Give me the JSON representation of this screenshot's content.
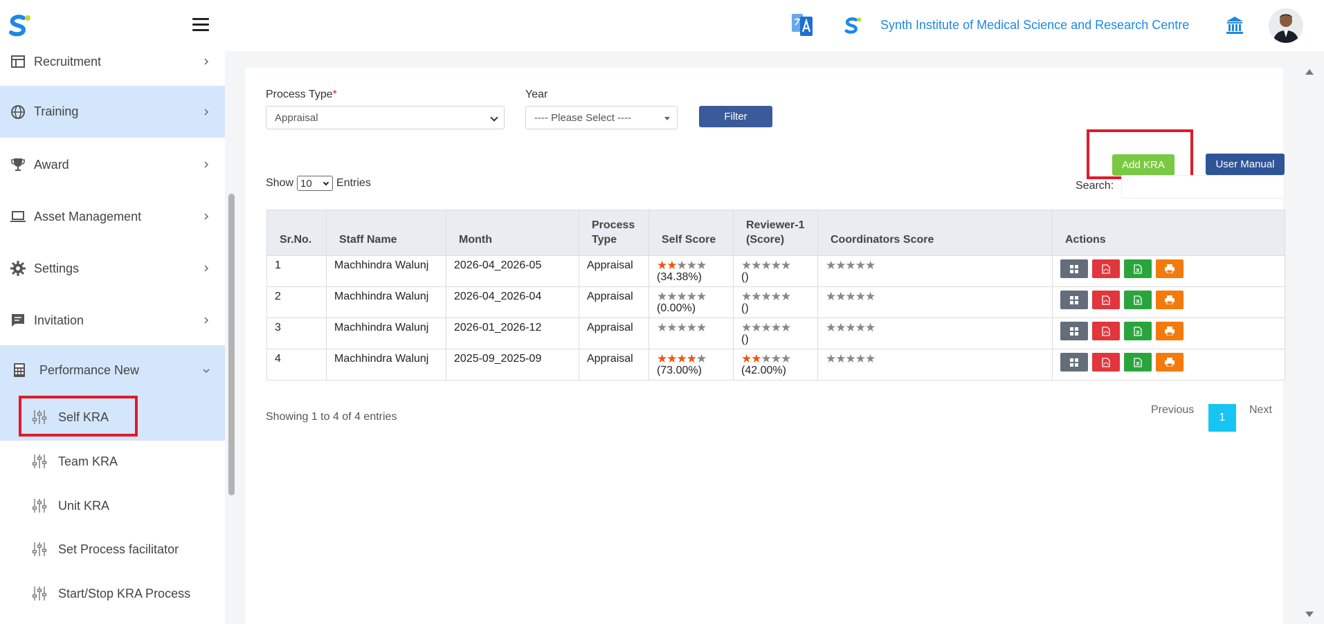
{
  "header": {
    "institute_name": "Synth Institute of Medical Science and Research Centre"
  },
  "sidebar": {
    "items": [
      {
        "label": "Recruitment",
        "icon": "recruitment-icon"
      },
      {
        "label": "Training",
        "icon": "globe-icon"
      },
      {
        "label": "Award",
        "icon": "trophy-icon"
      },
      {
        "label": "Asset Management",
        "icon": "laptop-icon"
      },
      {
        "label": "Settings",
        "icon": "gear-icon"
      },
      {
        "label": "Invitation",
        "icon": "chat-icon"
      },
      {
        "label": "Performance New",
        "icon": "calculator-icon"
      }
    ],
    "sub_items": [
      {
        "label": "Self KRA"
      },
      {
        "label": "Team KRA"
      },
      {
        "label": "Unit KRA"
      },
      {
        "label": "Set Process facilitator"
      },
      {
        "label": "Start/Stop KRA Process"
      }
    ]
  },
  "filters": {
    "process_type_label": "Process Type",
    "required_mark": "*",
    "process_type_value": "Appraisal",
    "year_label": "Year",
    "year_value": "---- Please Select ----",
    "filter_button": "Filter"
  },
  "toolbar": {
    "add_kra": "Add KRA",
    "user_manual": "User Manual"
  },
  "table_controls": {
    "show_label": "Show",
    "entries_value": "10",
    "entries_label": "Entries",
    "search_label": "Search:"
  },
  "table": {
    "headers": [
      "Sr.No.",
      "Staff Name",
      "Month",
      "Process Type",
      "Self Score",
      "Reviewer-1 (Score)",
      "Coordinators Score",
      "Actions"
    ],
    "rows": [
      {
        "sr": "1",
        "name": "Machhindra Walunj",
        "month": "2026-04_2026-05",
        "type": "Appraisal",
        "self_stars": 2,
        "self_pct": "(34.38%)",
        "rev_stars": 0,
        "rev_pct": "()",
        "coord_stars": 0
      },
      {
        "sr": "2",
        "name": "Machhindra Walunj",
        "month": "2026-04_2026-04",
        "type": "Appraisal",
        "self_stars": 0,
        "self_pct": "(0.00%)",
        "rev_stars": 0,
        "rev_pct": "()",
        "coord_stars": 0
      },
      {
        "sr": "3",
        "name": "Machhindra Walunj",
        "month": "2026-01_2026-12",
        "type": "Appraisal",
        "self_stars": 0,
        "self_pct": "",
        "rev_stars": 0,
        "rev_pct": "()",
        "coord_stars": 0
      },
      {
        "sr": "4",
        "name": "Machhindra Walunj",
        "month": "2025-09_2025-09",
        "type": "Appraisal",
        "self_stars": 4,
        "self_pct": "(73.00%)",
        "rev_stars": 2,
        "rev_pct": "(42.00%)",
        "coord_stars": 0
      }
    ]
  },
  "pagination": {
    "info": "Showing 1 to 4 of 4 entries",
    "previous": "Previous",
    "page": "1",
    "next": "Next"
  },
  "colors": {
    "accent": "#1e88e5",
    "active_nav": "#d4e6fb",
    "highlight": "#e01a2b",
    "star_on": "#f2540c"
  }
}
